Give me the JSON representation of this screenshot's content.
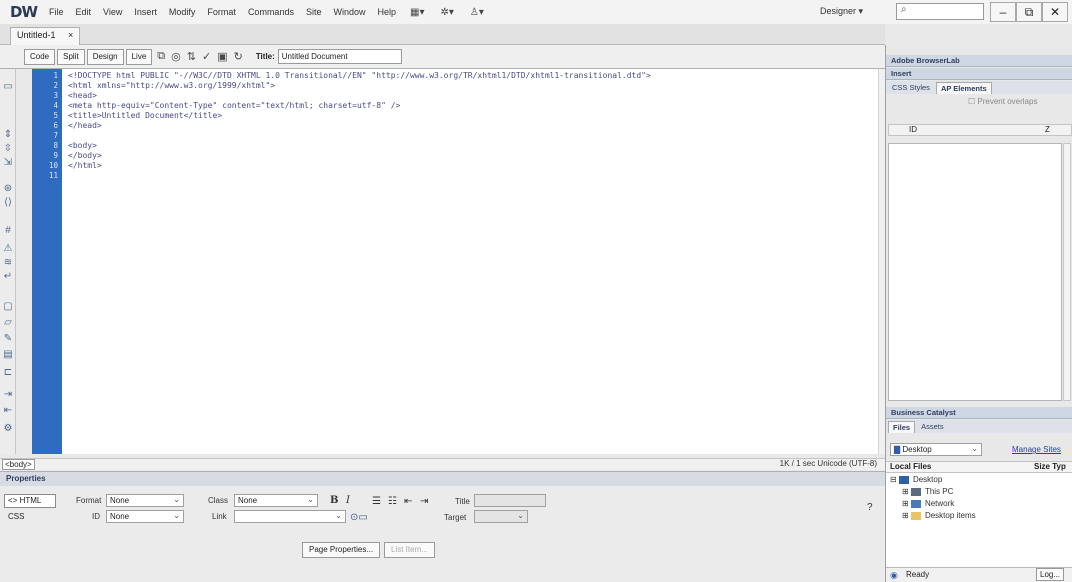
{
  "app": {
    "logo": "DW",
    "menus": [
      "File",
      "Edit",
      "View",
      "Insert",
      "Modify",
      "Format",
      "Commands",
      "Site",
      "Window",
      "Help"
    ],
    "workspace": "Designer",
    "workspace_arrow": "▾",
    "window_buttons": [
      "–",
      "⧉",
      "✕"
    ]
  },
  "document": {
    "tab_label": "Untitled-1",
    "tab_close": "×",
    "view_buttons": [
      "Code",
      "Split",
      "Design",
      "Live"
    ],
    "title_label": "Title:",
    "title_value": "Untitled Document"
  },
  "code": {
    "line_numbers": [
      "1",
      "2",
      "3",
      "4",
      "5",
      "6",
      "7",
      "8",
      "9",
      "10",
      "11"
    ],
    "lines": [
      "<!DOCTYPE html PUBLIC \"-//W3C//DTD XHTML 1.0 Transitional//EN\" \"http://www.w3.org/TR/xhtml1/DTD/xhtml1-transitional.dtd\">",
      "<html xmlns=\"http://www.w3.org/1999/xhtml\">",
      "<head>",
      "<meta http-equiv=\"Content-Type\" content=\"text/html; charset=utf-8\" />",
      "<title>Untitled Document</title>",
      "</head>",
      "",
      "<body>",
      "</body>",
      "</html>",
      ""
    ]
  },
  "status": {
    "tag": "<body>",
    "info": "1K / 1 sec  Unicode (UTF-8)"
  },
  "properties": {
    "header": "Properties",
    "html_btn": "<> HTML",
    "css_btn": "CSS",
    "format_label": "Format",
    "format_value": "None",
    "id_label": "ID",
    "id_value": "None",
    "class_label": "Class",
    "class_value": "None",
    "link_label": "Link",
    "title_label": "Title",
    "target_label": "Target",
    "bold": "B",
    "italic": "I",
    "page_properties": "Page Properties...",
    "list_item": "List Item..."
  },
  "panels": {
    "browserlab": "Adobe BrowserLab",
    "insert": "Insert",
    "css_tab": "CSS Styles",
    "ap_tab": "AP Elements",
    "prevent_overlaps": "Prevent overlaps",
    "col_id": "ID",
    "col_z": "Z",
    "business_catalyst": "Business Catalyst",
    "files_tab": "Files",
    "assets_tab": "Assets",
    "location": "Desktop",
    "manage_sites": "Manage Sites",
    "local_files": "Local Files",
    "size_type": "Size Typ",
    "tree": [
      "Desktop",
      "This PC",
      "Network",
      "Desktop items"
    ],
    "ready": "Ready",
    "log": "Log..."
  },
  "colors": {
    "gutter": "#2f6cc0",
    "code_text": "#4a4a8a",
    "panel_header": "#cfd7e3"
  }
}
